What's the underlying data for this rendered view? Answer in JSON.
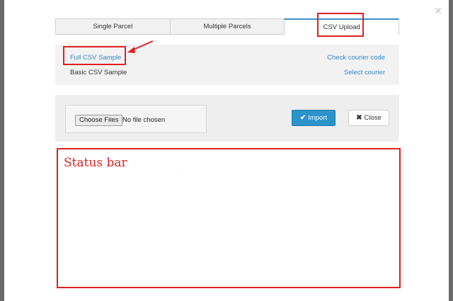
{
  "modal": {
    "close_glyph": "✕",
    "tabs": [
      {
        "label": "Single Parcel",
        "active": false
      },
      {
        "label": "Multiple Parcels",
        "active": false
      },
      {
        "label": "CSV Upload",
        "active": true
      }
    ],
    "samples": {
      "full_csv": "Full CSV Sample",
      "basic_csv": "Basic CSV Sample",
      "check_courier": "Check courier code",
      "select_courier": "Select courier"
    },
    "upload": {
      "choose_files": "Choose Files",
      "no_file": "No file chosen",
      "import_label": "Import",
      "close_label": "Close"
    },
    "status": {
      "label": "Status bar"
    }
  },
  "colors": {
    "accent": "#2a93c9",
    "link": "#3a87c6",
    "highlight": "#e02020"
  },
  "icons": {
    "import": "check-icon",
    "close": "x-icon"
  }
}
